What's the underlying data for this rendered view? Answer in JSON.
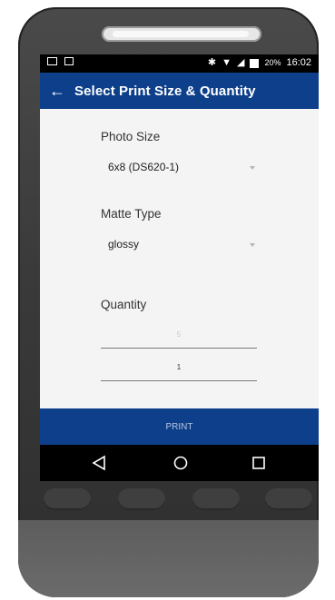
{
  "status_bar": {
    "battery": "20%",
    "time": "16:02",
    "icons": [
      "image-icon",
      "sim-card-icon",
      "bluetooth-icon",
      "wifi-icon",
      "signal-icon",
      "battery-icon"
    ]
  },
  "app_bar": {
    "title": "Select Print Size & Quantity",
    "back_icon": "arrow-left-icon"
  },
  "form": {
    "photo_size": {
      "label": "Photo Size",
      "value": "6x8  (DS620-1)"
    },
    "matte_type": {
      "label": "Matte Type",
      "value": "glossy"
    },
    "quantity": {
      "label": "Quantity",
      "field1_placeholder": "5",
      "field2_value": "1"
    }
  },
  "actions": {
    "print_label": "PRINT"
  },
  "nav_bar": {
    "icons": [
      "back-triangle-icon",
      "home-circle-icon",
      "recents-square-icon"
    ]
  },
  "colors": {
    "primary": "#0d3f8a",
    "status_bar": "#000000",
    "background": "#f4f4f4"
  }
}
